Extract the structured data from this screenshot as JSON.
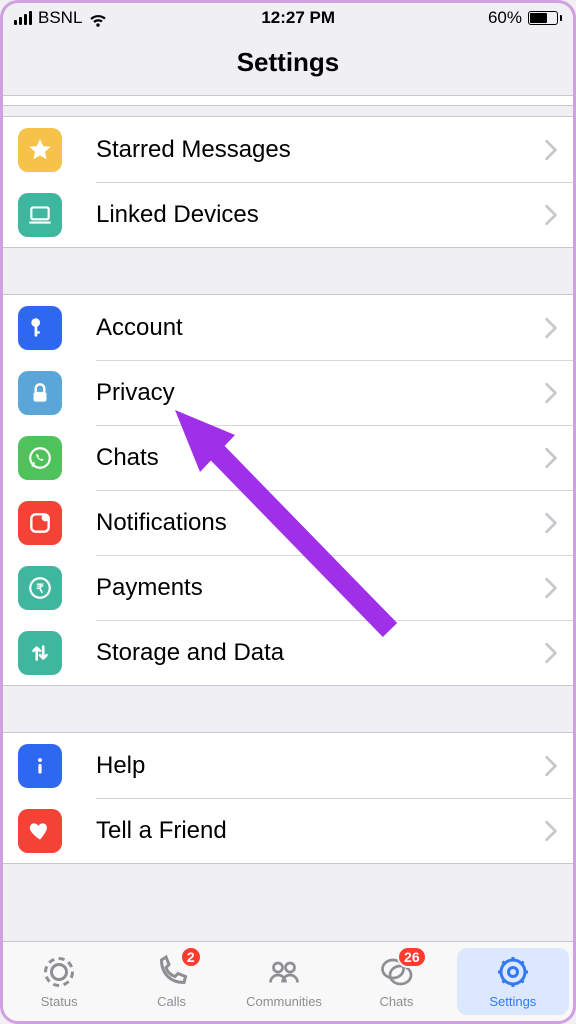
{
  "status_bar": {
    "carrier": "BSNL",
    "time": "12:27 PM",
    "battery_percent": "60%"
  },
  "header": {
    "title": "Settings"
  },
  "groups": {
    "g1": {
      "starred": "Starred Messages",
      "linked": "Linked Devices"
    },
    "g2": {
      "account": "Account",
      "privacy": "Privacy",
      "chats": "Chats",
      "notifications": "Notifications",
      "payments": "Payments",
      "storage": "Storage and Data"
    },
    "g3": {
      "help": "Help",
      "tell": "Tell a Friend"
    }
  },
  "tabs": {
    "status": "Status",
    "calls": "Calls",
    "communities": "Communities",
    "chats": "Chats",
    "settings": "Settings",
    "calls_badge": "2",
    "chats_badge": "26"
  }
}
